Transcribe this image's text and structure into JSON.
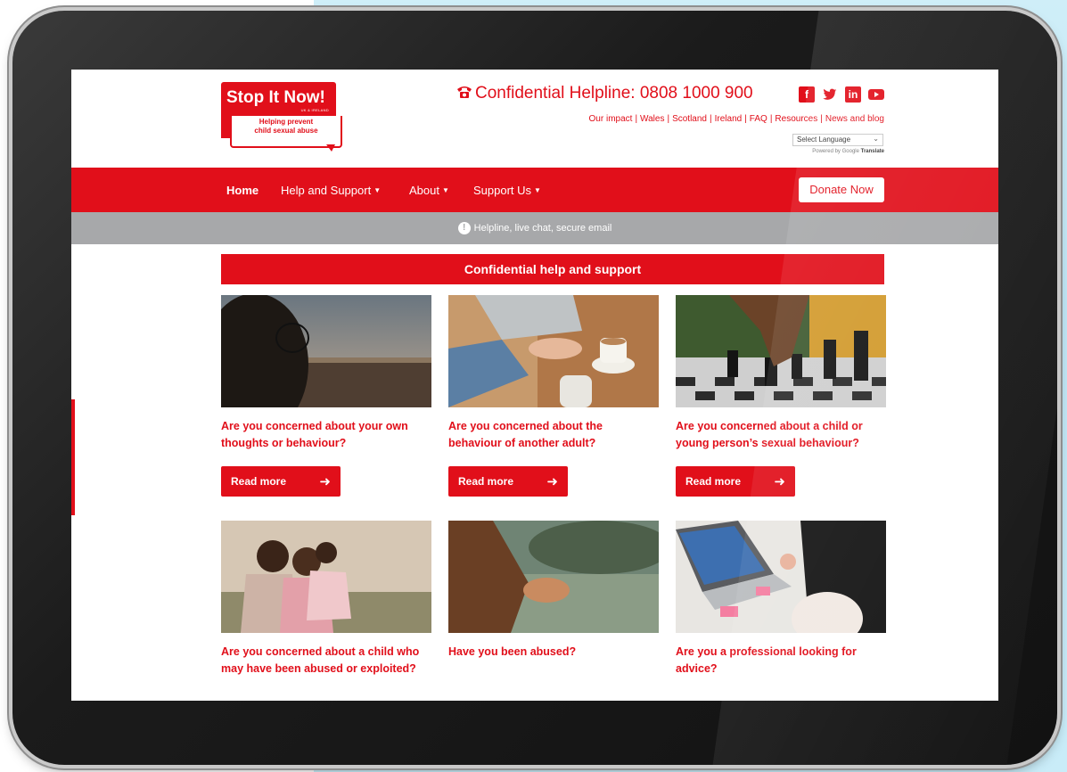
{
  "logo": {
    "title": "Stop It Now!",
    "region": "UK & IRELAND",
    "tagline_1": "Helping prevent",
    "tagline_2": "child sexual abuse"
  },
  "helpline": {
    "label": "Confidential Helpline: 0808 1000 900",
    "icon": "phone-icon"
  },
  "social": [
    {
      "name": "facebook-icon",
      "glyph": "f"
    },
    {
      "name": "twitter-icon",
      "glyph": "🐦"
    },
    {
      "name": "linkedin-icon",
      "glyph": "in"
    },
    {
      "name": "youtube-icon",
      "glyph": "▶"
    }
  ],
  "top_links": [
    "Our impact",
    "Wales",
    "Scotland",
    "Ireland",
    "FAQ",
    "Resources",
    "News and blog"
  ],
  "language": {
    "select_label": "Select Language",
    "powered_prefix": "Powered by",
    "powered_google": "Google",
    "powered_suffix": "Translate"
  },
  "nav": {
    "home": "Home",
    "help_support": "Help and Support",
    "about": "About",
    "support_us": "Support Us",
    "donate": "Donate Now"
  },
  "info_bar": "Helpline, live chat, secure email",
  "banner": "Confidential help and support",
  "cards": [
    {
      "title": "Are you concerned about your own thoughts or behaviour?",
      "button": "Read more"
    },
    {
      "title": "Are you concerned about the behaviour of another adult?",
      "button": "Read more"
    },
    {
      "title": "Are you concerned about a child or young person’s sexual behaviour?",
      "button": "Read more"
    },
    {
      "title": "Are you concerned about a child who may have been abused or exploited?"
    },
    {
      "title": "Have you been abused?"
    },
    {
      "title": "Are you a professional looking for advice?"
    }
  ],
  "colors": {
    "brand_red": "#e10f1a",
    "info_grey": "#a7a8aa",
    "backdrop": "#c6eaf7"
  }
}
